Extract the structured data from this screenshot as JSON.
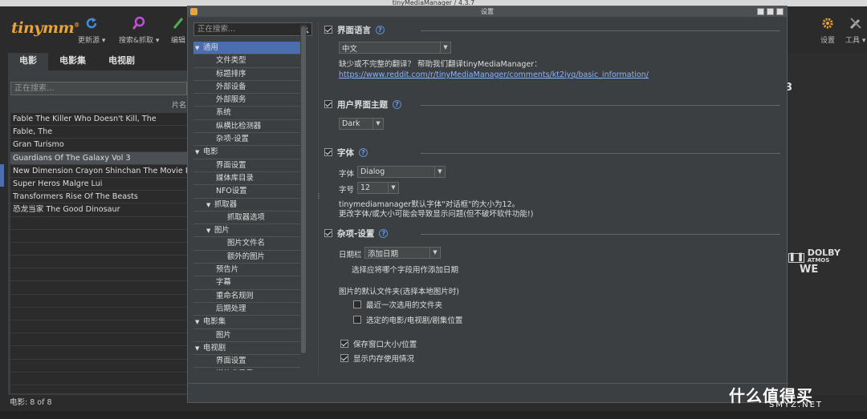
{
  "window_title": "tinyMediaManager / 4.3.7",
  "app": {
    "logo": "tinymm",
    "logo_mark": "®"
  },
  "toolbar": {
    "update_label": "更新源 ▾",
    "search_label": "搜索&抓取 ▾",
    "edit_label": "编辑",
    "settings_label": "设置",
    "tools_label": "工具 ▾"
  },
  "tabs": [
    "电影",
    "电影集",
    "电视剧"
  ],
  "left": {
    "search_placeholder": "正在搜索...",
    "column_header": "片名",
    "movies": [
      "Fable The Killer Who Doesn't Kill, The",
      "Fable, The",
      "Gran Turismo",
      "Guardians Of The Galaxy Vol 3",
      "New Dimension Crayon Shinchan The Movie Battle",
      "Super Heros Malgre Lui",
      "Transformers Rise Of The Beasts",
      "恐龙当家 The Good Dinosaur"
    ],
    "status": "电影:  8  of  8"
  },
  "dialog": {
    "title": "设置",
    "search_placeholder": "正在搜索...",
    "tree": [
      {
        "label": "通用",
        "level": 0,
        "expanded": true,
        "selected": true
      },
      {
        "label": "文件类型",
        "level": 1
      },
      {
        "label": "标题排序",
        "level": 1
      },
      {
        "label": "外部设备",
        "level": 1
      },
      {
        "label": "外部服务",
        "level": 1
      },
      {
        "label": "系统",
        "level": 1
      },
      {
        "label": "纵横比检测器",
        "level": 1
      },
      {
        "label": "杂项-设置",
        "level": 1
      },
      {
        "label": "电影",
        "level": 0,
        "expanded": true
      },
      {
        "label": "界面设置",
        "level": 1
      },
      {
        "label": "媒体库目录",
        "level": 1
      },
      {
        "label": "NFO设置",
        "level": 1
      },
      {
        "label": "抓取器",
        "level": 1,
        "group": true,
        "expanded": true
      },
      {
        "label": "抓取器选项",
        "level": 2
      },
      {
        "label": "图片",
        "level": 1,
        "group": true,
        "expanded": true
      },
      {
        "label": "图片文件名",
        "level": 2
      },
      {
        "label": "额外的图片",
        "level": 2
      },
      {
        "label": "预告片",
        "level": 1
      },
      {
        "label": "字幕",
        "level": 1
      },
      {
        "label": "重命名规则",
        "level": 1
      },
      {
        "label": "后期处理",
        "level": 1
      },
      {
        "label": "电影集",
        "level": 0,
        "expanded": true
      },
      {
        "label": "图片",
        "level": 1
      },
      {
        "label": "电视剧",
        "level": 0,
        "expanded": true
      },
      {
        "label": "界面设置",
        "level": 1
      },
      {
        "label": "媒体库目录",
        "level": 1
      }
    ],
    "language": {
      "heading": "界面语言",
      "value": "中文",
      "hint": "缺少或不完整的翻译？ 帮助我们翻译tinyMediaManager：",
      "link": "https://www.reddit.com/r/tinyMediaManager/comments/kt2iyq/basic_information/"
    },
    "theme": {
      "heading": "用户界面主题",
      "value": "Dark"
    },
    "font": {
      "heading": "字体",
      "family_label": "字体",
      "family_value": "Dialog",
      "size_label": "字号",
      "size_value": "12",
      "note1": "tinymediamanager默认字体\"对话框\"的大小为12。",
      "note2": "更改字体/或大小可能会导致显示问题(但不破坏软件功能!)"
    },
    "misc": {
      "heading": "杂项-设置",
      "date_label": "日期栏",
      "date_value": "添加日期",
      "date_hint": "选择应将哪个字段用作添加日期",
      "image_folder_label": "图片的默认文件夹(选择本地图片时)",
      "opt_last_folder": "最近一次选用的文件夹",
      "opt_media_folder": "选定的电影/电视剧/剧集位置",
      "opt_save_window": "保存窗口大小/位置",
      "opt_show_memory": "显示内存使用情况"
    }
  },
  "background": {
    "digit": "3",
    "logo_dolby": "DOLBY",
    "logo_dolby_sub": "ATMOS",
    "logo_we": "WE"
  },
  "watermark": {
    "text": "什么值得买",
    "sub": "SMYZ.NET"
  }
}
